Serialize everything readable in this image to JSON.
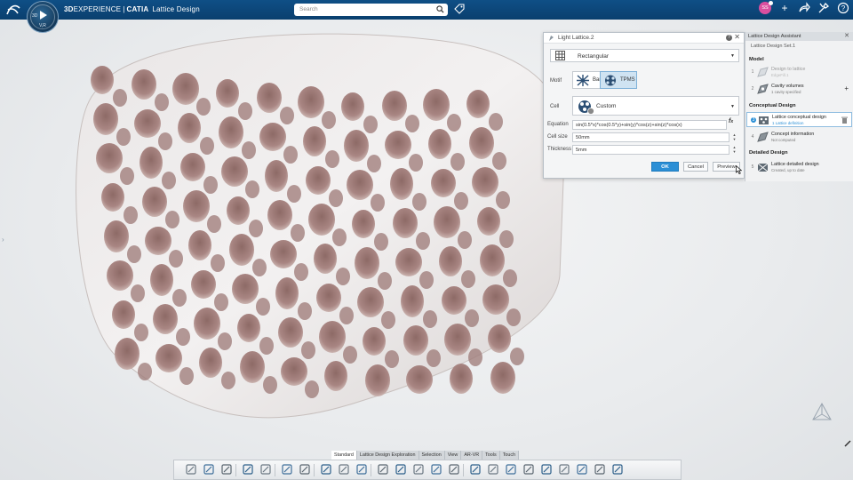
{
  "topbar": {
    "brand_3d": "3D",
    "brand_experience": "EXPERIENCE",
    "brand_sep": "|",
    "brand_catia": "CATIA",
    "app_name": "Lattice Design",
    "compass_3d": "3D",
    "compass_v": "V,R",
    "search_placeholder": "Search",
    "avatar_initials": "SS"
  },
  "dialog": {
    "title": "Light Lattice.2",
    "type_value": "Rectangular",
    "motif_label": "Motif",
    "motif_options": [
      "Bars",
      "TPMS"
    ],
    "motif_selected": "TPMS",
    "cell_label": "Cell",
    "cell_value": "Custom",
    "equation_label": "Equation",
    "equation_value": "sin(0.5*x)*cos(0.5*y)+sin(y)*cos(z)+sin(z)*cos(x)",
    "cell_size_label": "Cell size",
    "cell_size_value": "50mm",
    "thickness_label": "Thickness",
    "thickness_value": "5mm",
    "ok_label": "OK",
    "cancel_label": "Cancel",
    "preview_label": "Preview"
  },
  "assistant": {
    "title": "Lattice Design Assistant",
    "set_name": "Lattice Design Set.1",
    "sections": [
      {
        "title": "Model",
        "steps": [
          {
            "num": "1",
            "title": "Design to lattice",
            "subtitle": "EdgeFill.1",
            "state": "dim"
          },
          {
            "num": "2",
            "title": "Cavity volumes",
            "subtitle": "1 cavity specified",
            "state": "normal"
          }
        ]
      },
      {
        "title": "Conceptual Design",
        "steps": [
          {
            "num": "3",
            "title": "Lattice conceptual design",
            "subtitle": "1 Lattice definition",
            "state": "active"
          },
          {
            "num": "4",
            "title": "Concept information",
            "subtitle": "Not computed",
            "state": "normal"
          }
        ]
      },
      {
        "title": "Detailed Design",
        "steps": [
          {
            "num": "5",
            "title": "Lattice detailed design",
            "subtitle": "Created, up to date",
            "state": "normal"
          }
        ]
      }
    ]
  },
  "bottom_tabs": [
    "Standard",
    "Lattice Design Exploration",
    "Selection",
    "View",
    "AR-VR",
    "Tools",
    "Touch"
  ],
  "active_tab": "Standard",
  "toolbar_icons": [
    "cut-icon",
    "copy-icon",
    "paste-icon",
    "undo-icon",
    "zoom-icon",
    "book-icon",
    "snap-icon",
    "lattice-icon",
    "sketch-icon",
    "grid-cube-icon",
    "point-icon",
    "line-icon",
    "plane-icon",
    "axis-icon",
    "compass-move-icon",
    "measure-icon",
    "shell-icon",
    "box-icon",
    "bbox-icon",
    "ruler-icon",
    "component-icon",
    "group-icon",
    "assembly-icon",
    "cube-icon"
  ]
}
